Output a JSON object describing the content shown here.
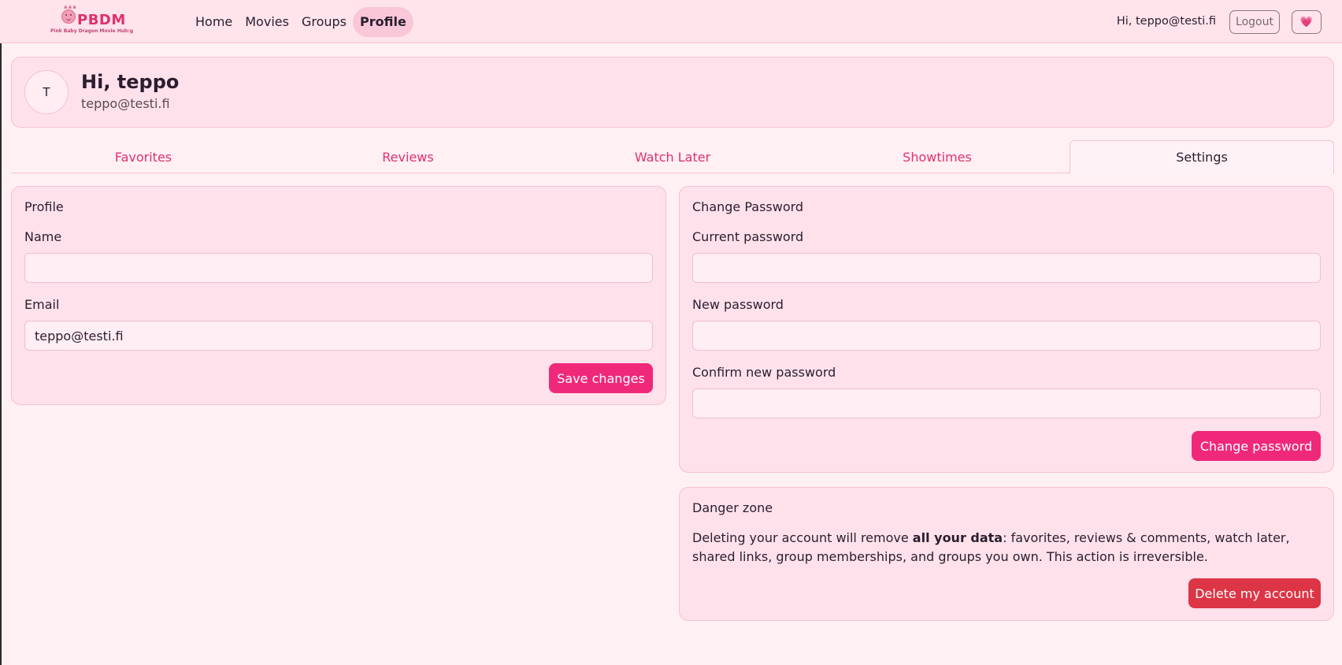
{
  "nav": {
    "logo_text": "PBDM",
    "logo_tagline": "Pink Baby Dragon Movie Hub:g",
    "links": [
      {
        "label": "Home"
      },
      {
        "label": "Movies"
      },
      {
        "label": "Groups"
      },
      {
        "label": "Profile",
        "active": true
      }
    ],
    "greeting": "Hi, teppo@testi.fi",
    "logout_label": "Logout",
    "theme_icon": "heart-icon"
  },
  "profile": {
    "avatar_initial": "T",
    "title": "Hi, teppo",
    "email": "teppo@testi.fi"
  },
  "tabs": [
    {
      "label": "Favorites"
    },
    {
      "label": "Reviews"
    },
    {
      "label": "Watch Later"
    },
    {
      "label": "Showtimes"
    },
    {
      "label": "Settings",
      "active": true
    }
  ],
  "profile_card": {
    "title": "Profile",
    "name_label": "Name",
    "name_value": "",
    "email_label": "Email",
    "email_value": "teppo@testi.fi",
    "save_label": "Save changes"
  },
  "password_card": {
    "title": "Change Password",
    "current_label": "Current password",
    "new_label": "New password",
    "confirm_label": "Confirm new password",
    "submit_label": "Change password"
  },
  "danger_card": {
    "title": "Danger zone",
    "text_before": "Deleting your account will remove ",
    "text_bold": "all your data",
    "text_after": ": favorites, reviews & comments, watch later, shared links, group memberships, and groups you own. This action is irreversible.",
    "delete_label": "Delete my account"
  },
  "colors": {
    "accent": "#f0287a",
    "danger": "#dc3545",
    "background": "#fff0f4",
    "card": "#ffe1eb"
  }
}
